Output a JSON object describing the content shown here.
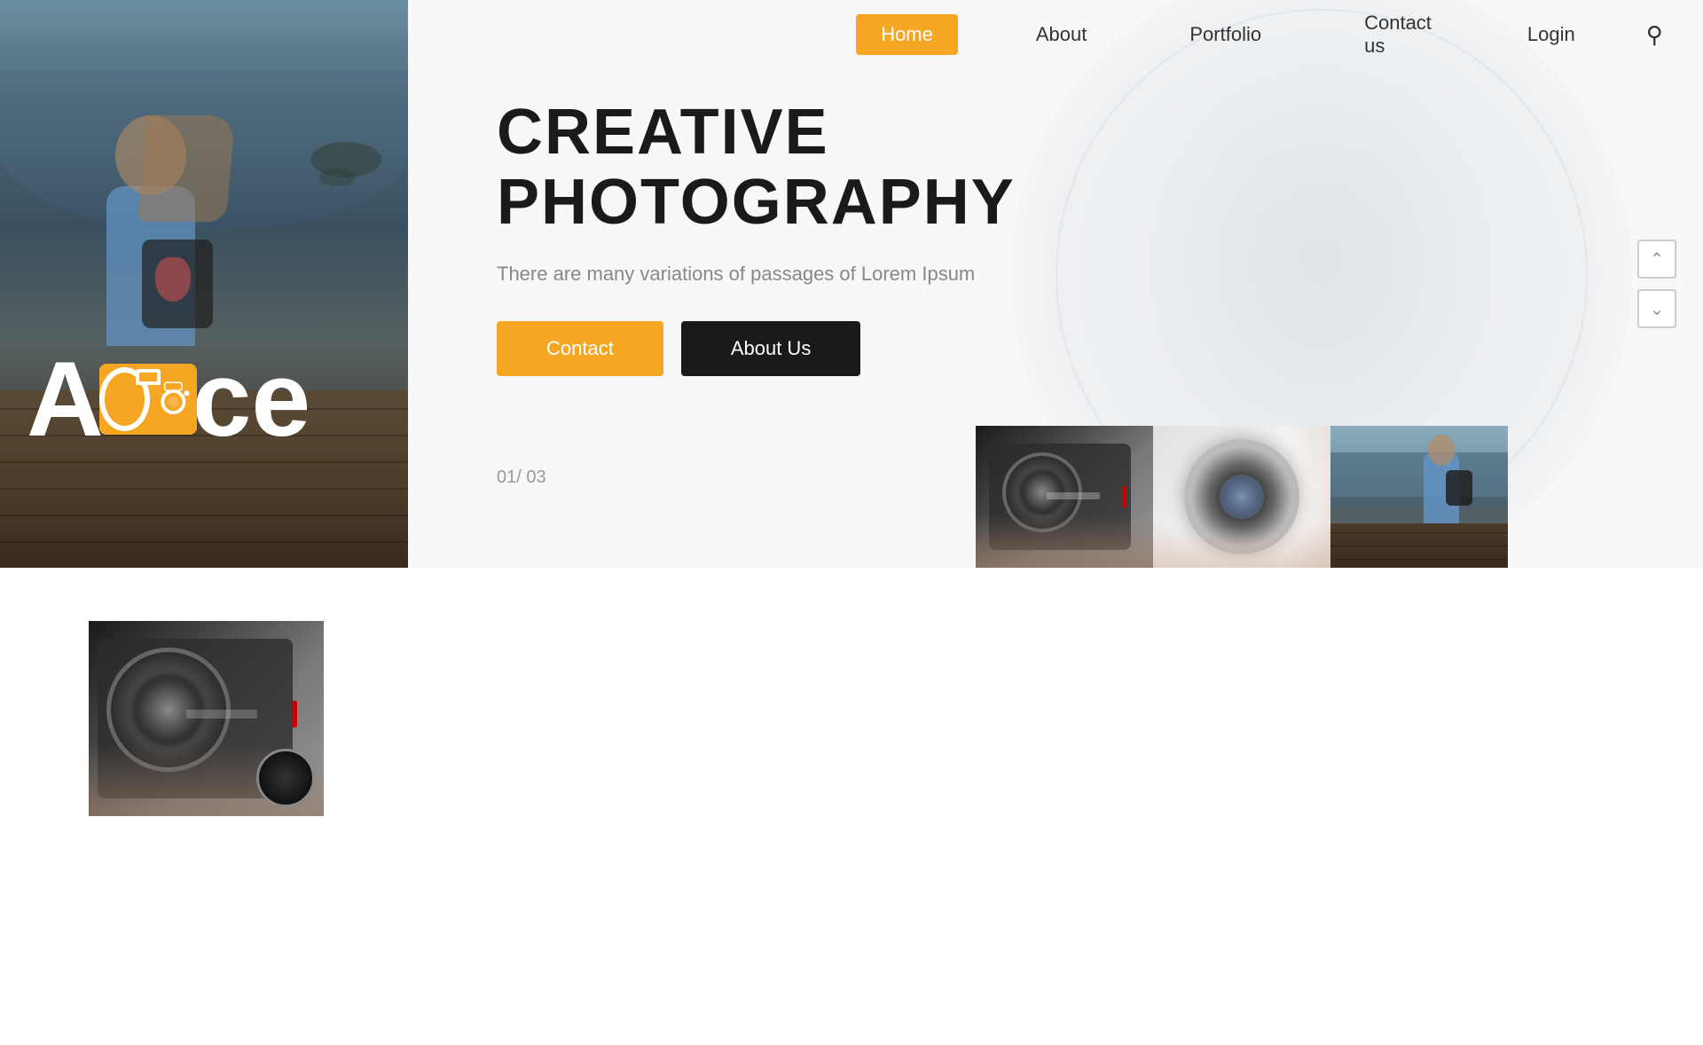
{
  "nav": {
    "items": [
      {
        "label": "Home",
        "active": true
      },
      {
        "label": "About",
        "active": false
      },
      {
        "label": "Portfolio",
        "active": false
      },
      {
        "label": "Contact us",
        "active": false
      }
    ],
    "login": "Login",
    "search_icon": "search"
  },
  "hero": {
    "brand_a": "A",
    "brand_rest": "ce",
    "sub_text": "Alce",
    "title_line1": "CREATIVE",
    "title_line2": "PHOTOGRAPHY",
    "description": "There are many variations of passages of Lorem Ipsum",
    "btn_contact": "Contact",
    "btn_about": "About Us",
    "slide_counter": "01/ 03",
    "arrow_up": "˄",
    "arrow_down": "˅"
  },
  "thumbnails": [
    {
      "alt": "camera close up"
    },
    {
      "alt": "camera lens"
    },
    {
      "alt": "girl with backpack"
    }
  ],
  "below": {
    "thumb_alt": "camera held by person"
  }
}
